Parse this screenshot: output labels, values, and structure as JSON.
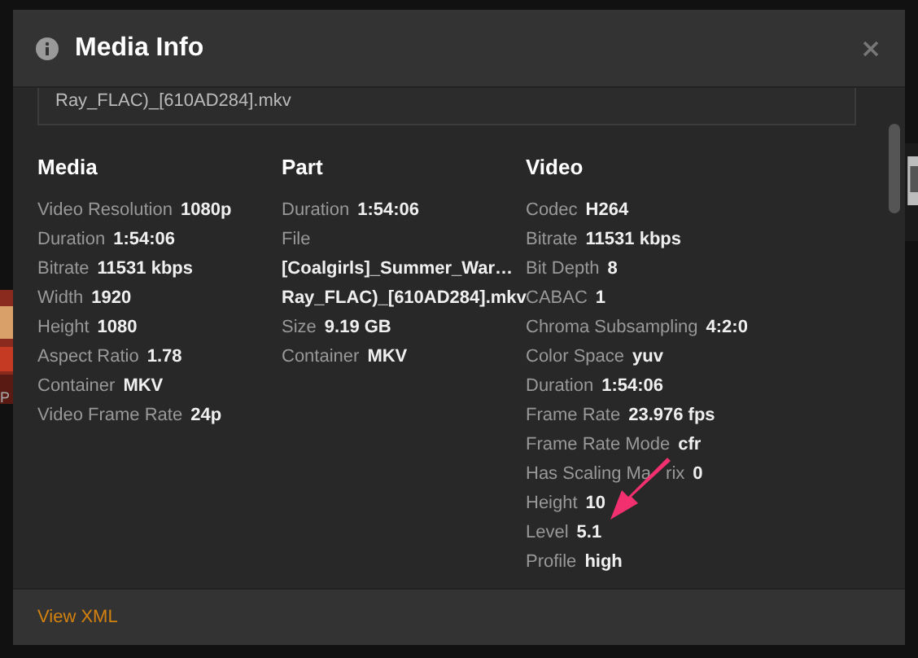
{
  "background": {
    "caption": "P"
  },
  "dialog": {
    "title": "Media Info",
    "file_box": "Ray_FLAC)_[610AD284].mkv",
    "sections": [
      {
        "title": "Media",
        "rows": [
          {
            "label": "Video Resolution",
            "value": "1080p"
          },
          {
            "label": "Duration",
            "value": "1:54:06"
          },
          {
            "label": "Bitrate",
            "value": "11531 kbps"
          },
          {
            "label": "Width",
            "value": "1920"
          },
          {
            "label": "Height",
            "value": "1080"
          },
          {
            "label": "Aspect Ratio",
            "value": "1.78"
          },
          {
            "label": "Container",
            "value": "MKV"
          },
          {
            "label": "Video Frame Rate",
            "value": "24p"
          }
        ]
      },
      {
        "title": "Part",
        "rows": [
          {
            "label": "Duration",
            "value": "1:54:06"
          },
          {
            "label": "File"
          },
          {
            "value": "[Coalgirls]_Summer_War…"
          },
          {
            "value": "Ray_FLAC)_[610AD284].mkv"
          },
          {
            "label": "Size",
            "value": "9.19 GB"
          },
          {
            "label": "Container",
            "value": "MKV"
          }
        ]
      },
      {
        "title": "Video",
        "rows": [
          {
            "label": "Codec",
            "value": "H264"
          },
          {
            "label": "Bitrate",
            "value": "11531 kbps"
          },
          {
            "label": "Bit Depth",
            "value": "8"
          },
          {
            "label": "CABAC",
            "value": "1"
          },
          {
            "label": "Chroma Subsampling",
            "value": "4:2:0"
          },
          {
            "label": "Color Space",
            "value": "yuv"
          },
          {
            "label": "Duration",
            "value": "1:54:06"
          },
          {
            "label": "Frame Rate",
            "value": "23.976 fps"
          },
          {
            "label": "Frame Rate Mode",
            "value": "cfr"
          },
          {
            "label": "Has Scaling Ma",
            "label_tail": "rix",
            "value": "0"
          },
          {
            "label": "Height",
            "value": "10"
          },
          {
            "label": "Level",
            "value": "5.1"
          },
          {
            "label": "Profile",
            "value": "high"
          }
        ]
      }
    ],
    "footer_link": "View XML"
  }
}
